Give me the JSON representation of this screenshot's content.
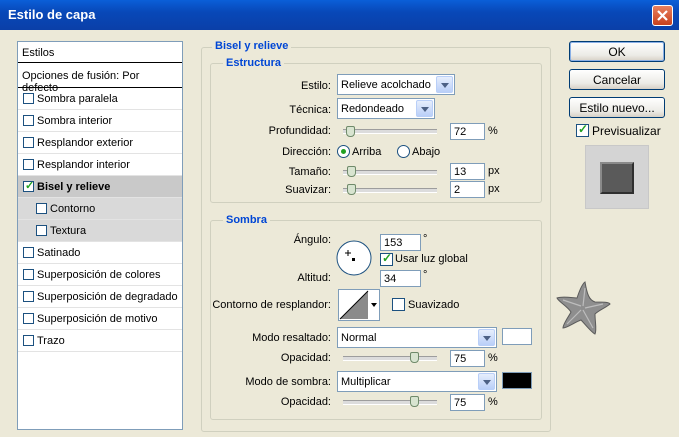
{
  "window": {
    "title": "Estilo de capa"
  },
  "styles_panel": {
    "header": "Estilos",
    "blending": "Opciones de fusión: Por defecto",
    "items": [
      {
        "label": "Sombra paralela",
        "checked": false
      },
      {
        "label": "Sombra interior",
        "checked": false
      },
      {
        "label": "Resplandor exterior",
        "checked": false
      },
      {
        "label": "Resplandor interior",
        "checked": false
      },
      {
        "label": "Bisel y relieve",
        "checked": true
      },
      {
        "label": "Contorno",
        "checked": false
      },
      {
        "label": "Textura",
        "checked": false
      },
      {
        "label": "Satinado",
        "checked": false
      },
      {
        "label": "Superposición de colores",
        "checked": false
      },
      {
        "label": "Superposición de degradado",
        "checked": false
      },
      {
        "label": "Superposición de motivo",
        "checked": false
      },
      {
        "label": "Trazo",
        "checked": false
      }
    ]
  },
  "bevel": {
    "group_title": "Bisel y relieve",
    "structure": {
      "title": "Estructura",
      "style_label": "Estilo:",
      "style_value": "Relieve acolchado",
      "technique_label": "Técnica:",
      "technique_value": "Redondeado",
      "depth_label": "Profundidad:",
      "depth_value": "72",
      "depth_unit": "%",
      "depth_slider": 0.07,
      "direction_label": "Dirección:",
      "dir_up": "Arriba",
      "dir_down": "Abajo",
      "size_label": "Tamaño:",
      "size_value": "13",
      "size_unit": "px",
      "size_slider": 0.08,
      "soften_label": "Suavizar:",
      "soften_value": "2",
      "soften_unit": "px",
      "soften_slider": 0.08
    },
    "shading": {
      "title": "Sombra",
      "angle_label": "Ángulo:",
      "angle_value": "153",
      "angle_unit": "°",
      "global_light_label": "Usar luz global",
      "altitude_label": "Altitud:",
      "altitude_value": "34",
      "altitude_unit": "°",
      "gloss_label": "Contorno de resplandor:",
      "antialias_label": "Suavizado",
      "highlight_mode_label": "Modo resaltado:",
      "highlight_mode_value": "Normal",
      "highlight_color": "#ffffff",
      "highlight_opacity_label": "Opacidad:",
      "highlight_opacity_value": "75",
      "highlight_opacity_unit": "%",
      "highlight_opacity_slider": 0.75,
      "shadow_mode_label": "Modo de sombra:",
      "shadow_mode_value": "Multiplicar",
      "shadow_color": "#000000",
      "shadow_opacity_label": "Opacidad:",
      "shadow_opacity_value": "75",
      "shadow_opacity_unit": "%",
      "shadow_opacity_slider": 0.75
    }
  },
  "buttons": {
    "ok": "OK",
    "cancel": "Cancelar",
    "new_style": "Estilo nuevo...",
    "preview": "Previsualizar"
  }
}
